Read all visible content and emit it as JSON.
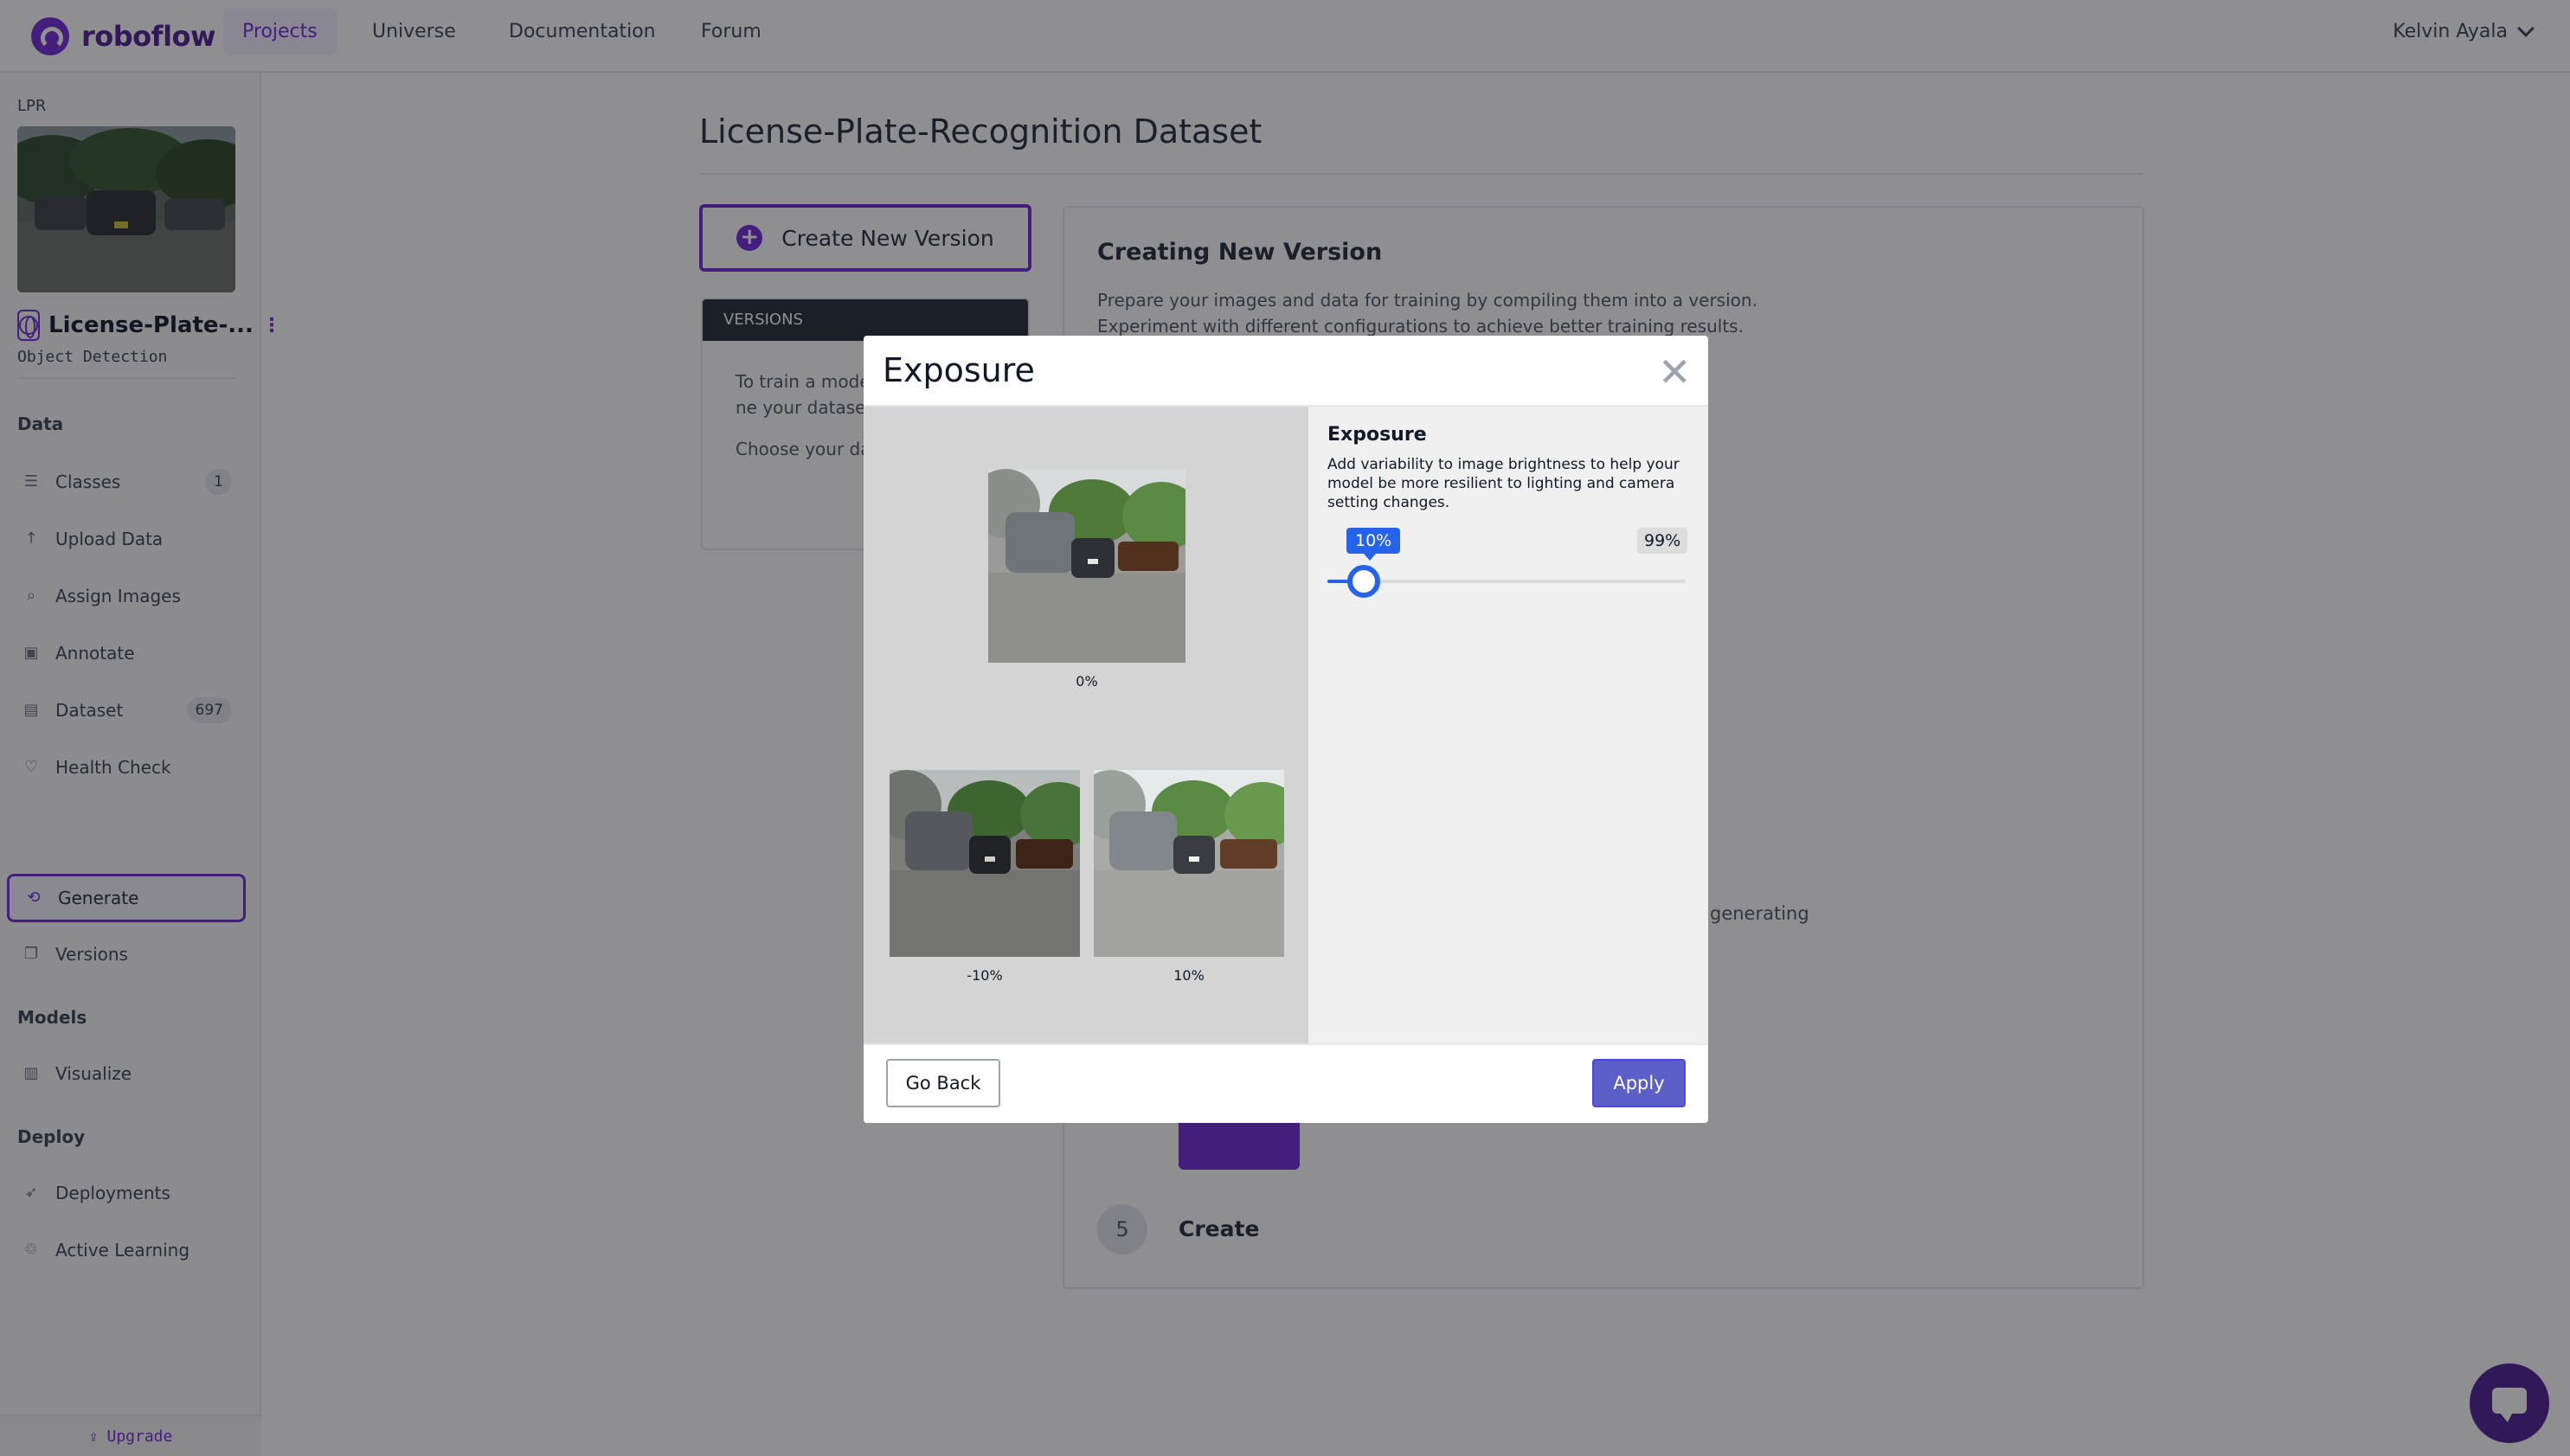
{
  "header": {
    "logo": "roboflow",
    "nav": [
      "Projects",
      "Universe",
      "Documentation",
      "Forum"
    ],
    "active_nav": "Projects",
    "user": "Kelvin Ayala"
  },
  "sidebar": {
    "project_tag": "LPR",
    "project_name": "License-Plate-...",
    "project_type": "Object Detection",
    "sections": {
      "data": "Data",
      "models": "Models",
      "deploy": "Deploy"
    },
    "items": [
      {
        "label": "Classes",
        "badge": "1",
        "icon": "list-icon"
      },
      {
        "label": "Upload Data",
        "icon": "upload-icon"
      },
      {
        "label": "Assign Images",
        "icon": "search-icon"
      },
      {
        "label": "Annotate",
        "icon": "annotate-icon"
      },
      {
        "label": "Dataset",
        "badge": "697",
        "icon": "images-icon"
      },
      {
        "label": "Health Check",
        "icon": "heart-icon"
      },
      {
        "label": "Generate",
        "icon": "generate-icon",
        "active": true
      },
      {
        "label": "Versions",
        "icon": "versions-icon"
      },
      {
        "label": "Visualize",
        "icon": "chart-icon"
      },
      {
        "label": "Deployments",
        "icon": "rocket-icon"
      },
      {
        "label": "Active Learning",
        "icon": "recycle-icon"
      }
    ],
    "upgrade": "Upgrade"
  },
  "main": {
    "title": "License-Plate-Recognition Dataset",
    "create_button": "Create New Version",
    "versions_header": "VERSIONS",
    "versions_text_1": "To train a mode first create a ne your dataset.",
    "versions_text_2": "Choose your da to get started.",
    "card_title": "Creating New Version",
    "card_desc_1": "Prepare your images and data for training by compiling them into a version.",
    "card_desc_2": "Experiment with different configurations to achieve better training results.",
    "card_generating": "generating",
    "step5_number": "5",
    "step5_label": "Create"
  },
  "modal": {
    "title": "Exposure",
    "close": "✕",
    "previews": {
      "center": "0%",
      "left": "-10%",
      "right": "10%"
    },
    "settings": {
      "title": "Exposure",
      "description": "Add variability to image brightness to help your model be more resilient to lighting and camera setting changes.",
      "value_label": "10%",
      "max_label": "99%",
      "value": 10,
      "max": 99
    },
    "go_back": "Go Back",
    "apply": "Apply"
  },
  "colors": {
    "brand": "#6d28d9",
    "slider": "#2563eb",
    "apply": "#5b5fc7"
  }
}
